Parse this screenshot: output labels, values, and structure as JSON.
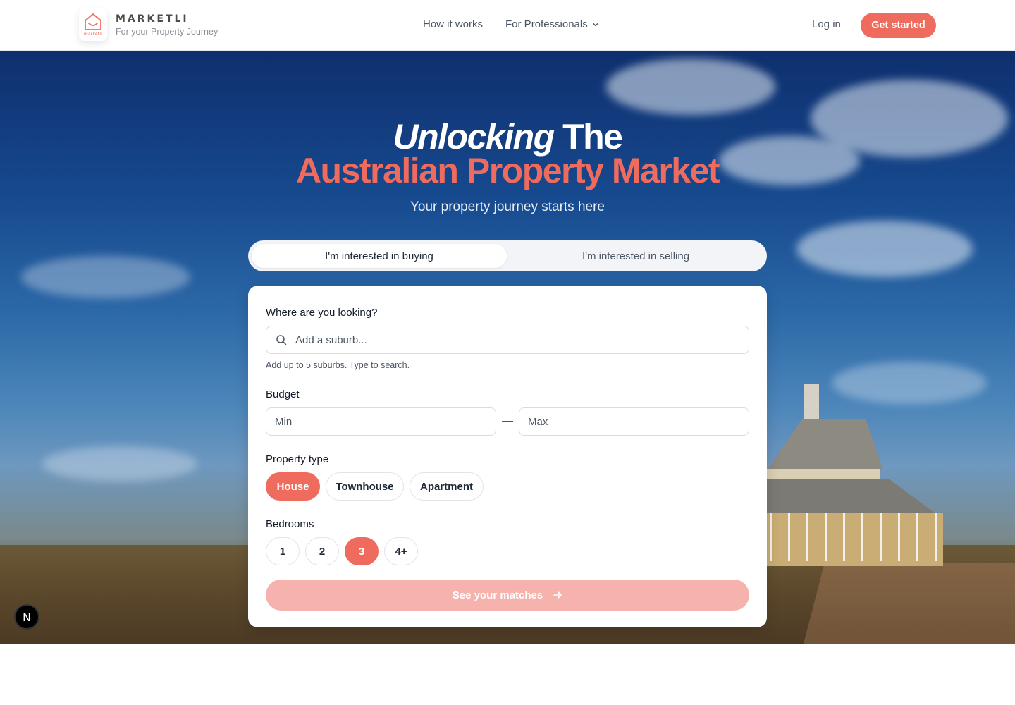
{
  "header": {
    "logo_word": "marketli",
    "brand_name": "MARKETLI",
    "brand_tagline": "For your Property Journey",
    "nav": {
      "how_it_works": "How it works",
      "for_professionals": "For Professionals"
    },
    "login_label": "Log in",
    "get_started_label": "Get started"
  },
  "hero": {
    "title_italic": "Unlocking",
    "title_rest": "The",
    "title_line2": "Australian Property Market",
    "subtitle": "Your property journey starts here"
  },
  "tabs": {
    "buying": "I'm interested in buying",
    "selling": "I'm interested in selling",
    "active": "buying"
  },
  "form": {
    "location_label": "Where are you looking?",
    "search_placeholder": "Add a suburb...",
    "search_hint": "Add up to 5 suburbs. Type to search.",
    "budget_label": "Budget",
    "budget_min_placeholder": "Min",
    "budget_max_placeholder": "Max",
    "property_type_label": "Property type",
    "property_types": [
      "House",
      "Townhouse",
      "Apartment"
    ],
    "property_type_selected": "House",
    "bedrooms_label": "Bedrooms",
    "bedrooms": [
      "1",
      "2",
      "3",
      "4+"
    ],
    "bedrooms_selected": "3",
    "cta_label": "See your matches"
  },
  "badge_letter": "N",
  "colors": {
    "accent": "#ef6b5e",
    "accent_light": "#f6b3ad",
    "header_bg": "#ffffff",
    "text": "#1f2937"
  },
  "icons": [
    "house-smile-logo-icon",
    "chevron-down-icon",
    "search-icon",
    "arrow-right-icon"
  ]
}
